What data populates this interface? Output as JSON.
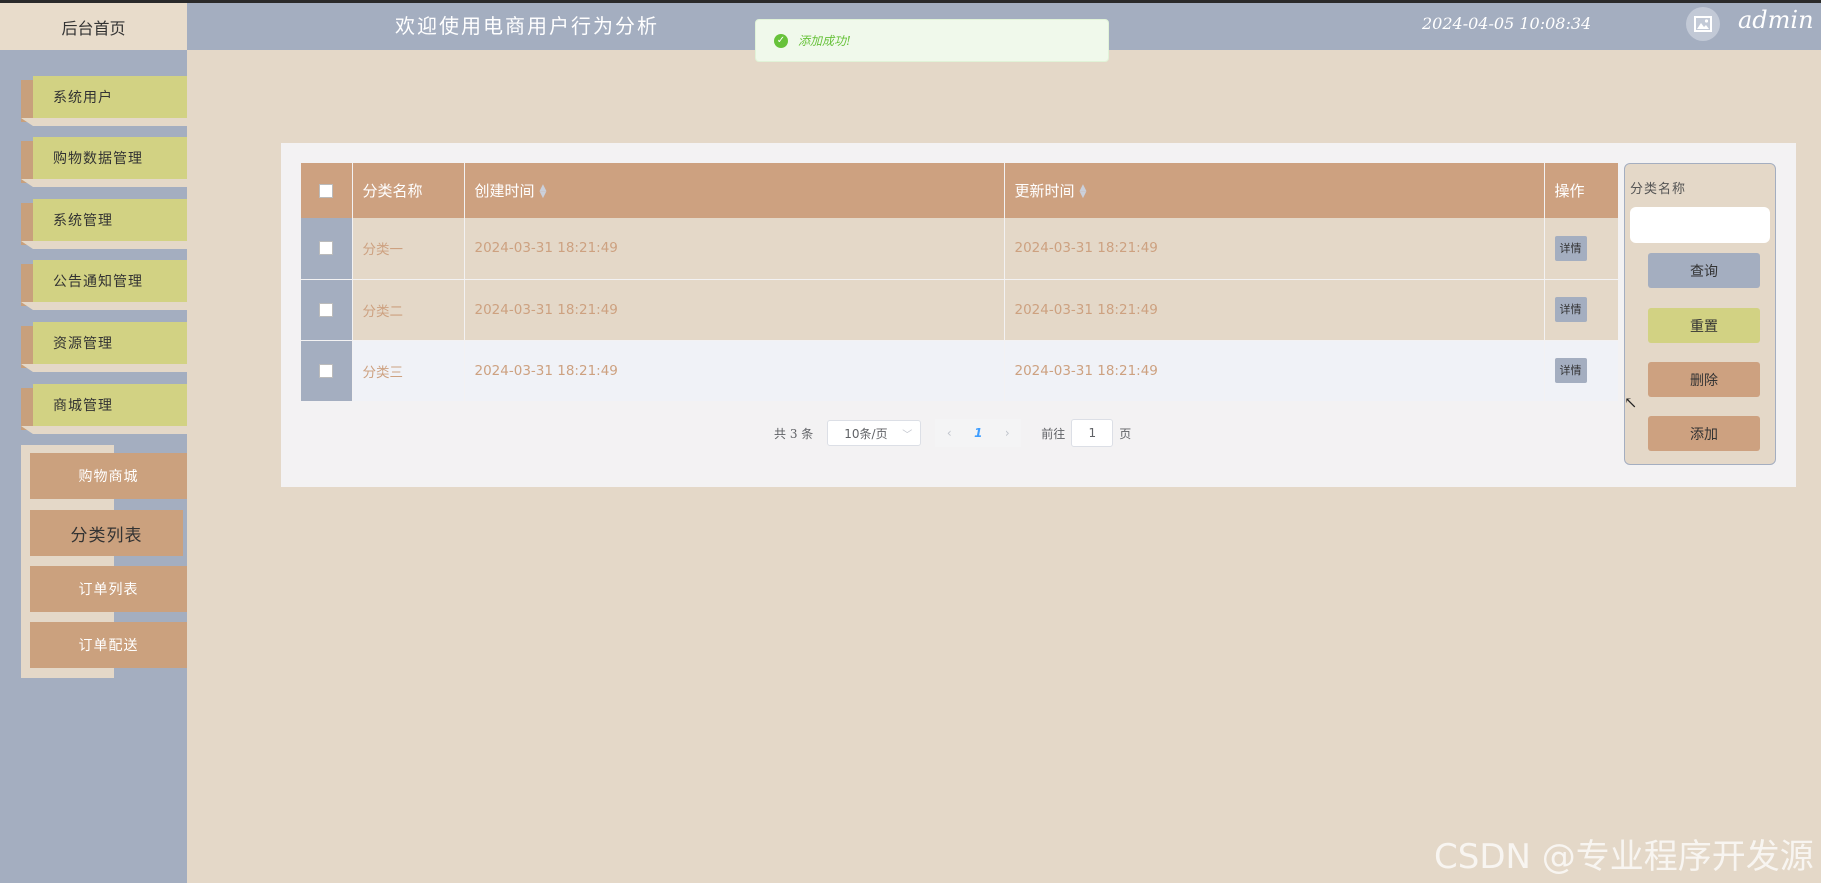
{
  "header": {
    "home_tab": "后台首页",
    "welcome": "欢迎使用电商用户行为分析",
    "datetime": "2024-04-05 10:08:34",
    "username": "admin"
  },
  "toast": {
    "message": "添加成功!"
  },
  "sidebar": {
    "items": [
      {
        "label": "系统用户"
      },
      {
        "label": "购物数据管理"
      },
      {
        "label": "系统管理"
      },
      {
        "label": "公告通知管理"
      },
      {
        "label": "资源管理"
      },
      {
        "label": "商城管理"
      }
    ],
    "subitems": [
      {
        "label": "购物商城"
      },
      {
        "label": "分类列表"
      },
      {
        "label": "订单列表"
      },
      {
        "label": "订单配送"
      }
    ]
  },
  "table": {
    "columns": [
      "分类名称",
      "创建时间",
      "更新时间",
      "操作"
    ],
    "rows": [
      {
        "name": "分类一",
        "created": "2024-03-31 18:21:49",
        "updated": "2024-03-31 18:21:49",
        "action": "详情"
      },
      {
        "name": "分类二",
        "created": "2024-03-31 18:21:49",
        "updated": "2024-03-31 18:21:49",
        "action": "详情"
      },
      {
        "name": "分类三",
        "created": "2024-03-31 18:21:49",
        "updated": "2024-03-31 18:21:49",
        "action": "详情"
      }
    ]
  },
  "pagination": {
    "total_text": "共 3 条",
    "page_size": "10条/页",
    "current_page": "1",
    "goto_label": "前往",
    "goto_value": "1",
    "page_unit": "页"
  },
  "search": {
    "label": "分类名称",
    "input_value": "",
    "query_label": "查询",
    "reset_label": "重置",
    "delete_label": "删除",
    "add_label": "添加"
  },
  "watermark": "CSDN @专业程序开发源",
  "colors": {
    "background": "#e4d8c8",
    "slate": "#a4aec0",
    "olive": "#d2d283",
    "tan": "#cda180",
    "success": "#67c23a"
  }
}
